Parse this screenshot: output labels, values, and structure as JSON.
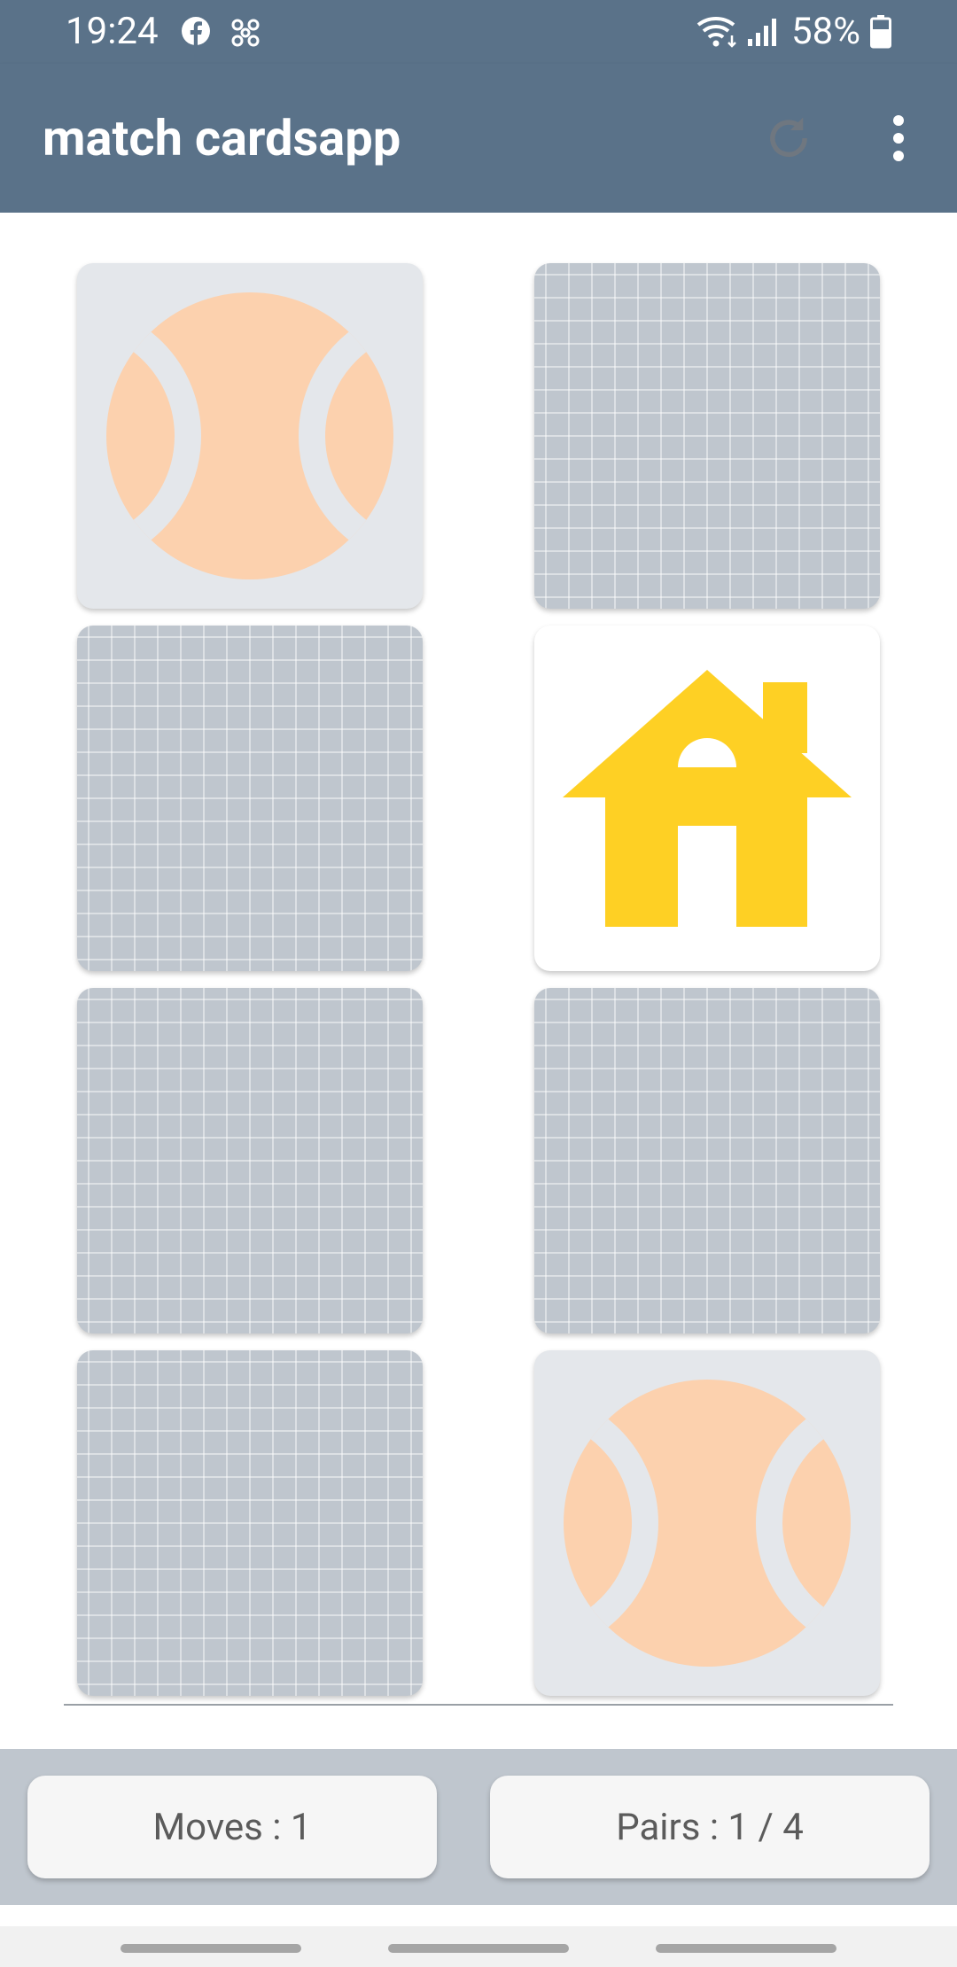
{
  "status_bar": {
    "time": "19:24",
    "battery_percent": "58%",
    "icons": [
      "facebook-icon",
      "fan-icon",
      "wifi-icon",
      "signal-icon",
      "battery-icon"
    ]
  },
  "app_bar": {
    "title": "match cardsapp",
    "actions": [
      "refresh-icon",
      "more-vert-icon"
    ]
  },
  "board": {
    "cards": [
      {
        "state": "revealed",
        "symbol": "ball-icon"
      },
      {
        "state": "hidden"
      },
      {
        "state": "hidden"
      },
      {
        "state": "revealed",
        "symbol": "house-icon"
      },
      {
        "state": "hidden"
      },
      {
        "state": "hidden"
      },
      {
        "state": "hidden"
      },
      {
        "state": "revealed",
        "symbol": "ball-icon"
      }
    ]
  },
  "footer": {
    "moves_label": "Moves : 1",
    "pairs_label": "Pairs : 1 / 4"
  },
  "colors": {
    "app_bar": "#5a7289",
    "card_back": "#bfc6ce",
    "ball": "#fcd1ae",
    "house": "#fed024"
  }
}
